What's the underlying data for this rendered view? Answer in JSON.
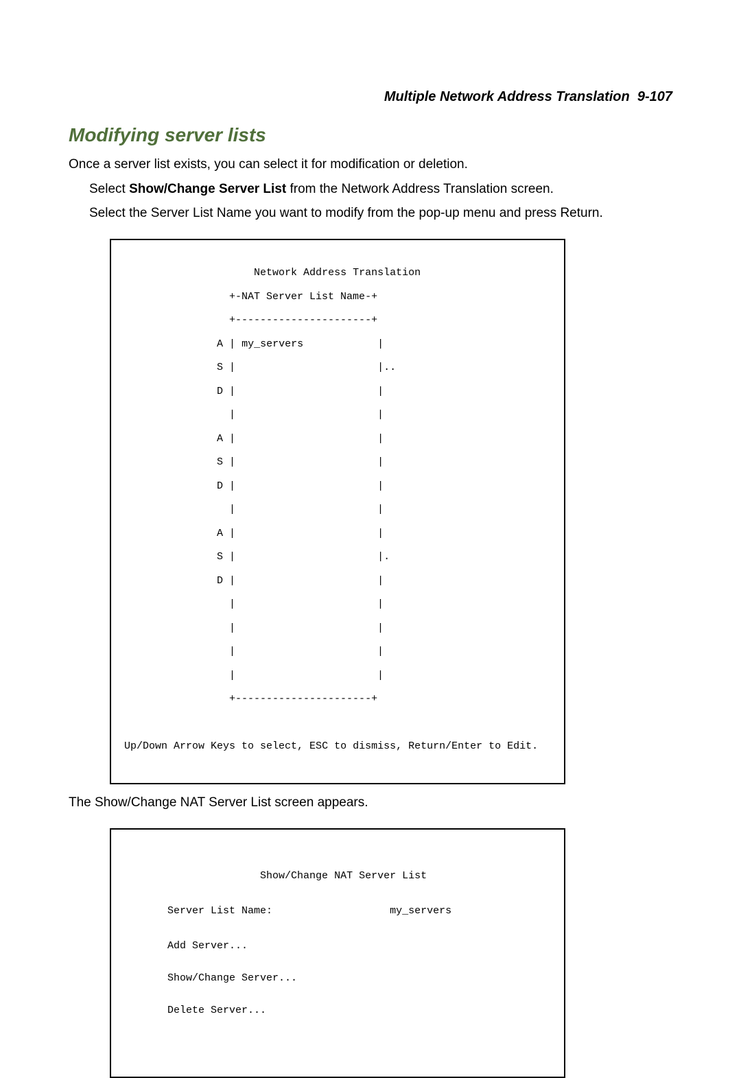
{
  "header": {
    "title": "Multiple Network Address Translation",
    "pagenum": "9-107"
  },
  "heading": "Modifying server lists",
  "intro": "Once a server list exists, you can select it for modification or deletion.",
  "step1_prefix": "Select ",
  "step1_bold": "Show/Change Server List",
  "step1_suffix": " from the Network Address Translation screen.",
  "step2": "Select the Server List Name you want to modify from the pop-up menu and press Return.",
  "screen1": {
    "title": "Network Address Translation",
    "popup_header": "+-NAT Server List Name-+",
    "divider_top": "+----------------------+",
    "col": [
      "A",
      "S",
      "D",
      "",
      "A",
      "S",
      "D",
      "",
      "A",
      "S",
      "D"
    ],
    "item": "my_servers",
    "dots_top": "..",
    "dot_mid": ".",
    "divider_bottom": "+----------------------+",
    "footer": "Up/Down Arrow Keys to select, ESC to dismiss, Return/Enter to Edit."
  },
  "after_screen1": "The Show/Change NAT Server List screen appears.",
  "screen2": {
    "title": "Show/Change NAT Server List",
    "field_label": "Server List Name:",
    "field_value": "my_servers",
    "menu": [
      "Add Server...",
      "Show/Change Server...",
      "Delete Server..."
    ]
  }
}
